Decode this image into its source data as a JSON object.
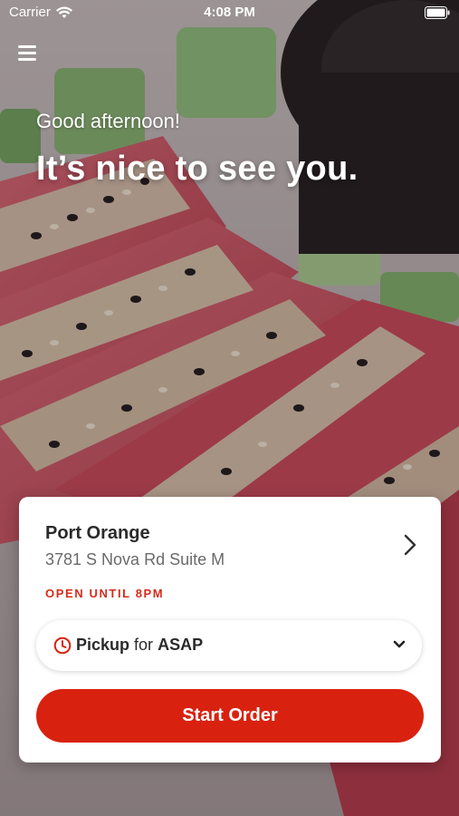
{
  "status_bar": {
    "carrier": "Carrier",
    "time": "4:08 PM"
  },
  "icons": {
    "menu": "hamburger-icon",
    "wifi": "wifi-icon",
    "battery": "battery-icon",
    "chevron": "chevron-right-icon",
    "clock": "clock-icon",
    "caret": "chevron-down-icon"
  },
  "hero": {
    "greeting": "Good afternoon!",
    "headline": "It’s nice to see you."
  },
  "store": {
    "name": "Port Orange",
    "address": "3781 S Nova Rd Suite M",
    "hours": "OPEN UNTIL 8PM"
  },
  "order_mode": {
    "mode": "Pickup",
    "connector": "for",
    "time": "ASAP"
  },
  "actions": {
    "start_order_label": "Start Order"
  },
  "colors": {
    "accent": "#d8220f",
    "hours_text": "#d62b1a",
    "card_background": "#ffffff"
  }
}
